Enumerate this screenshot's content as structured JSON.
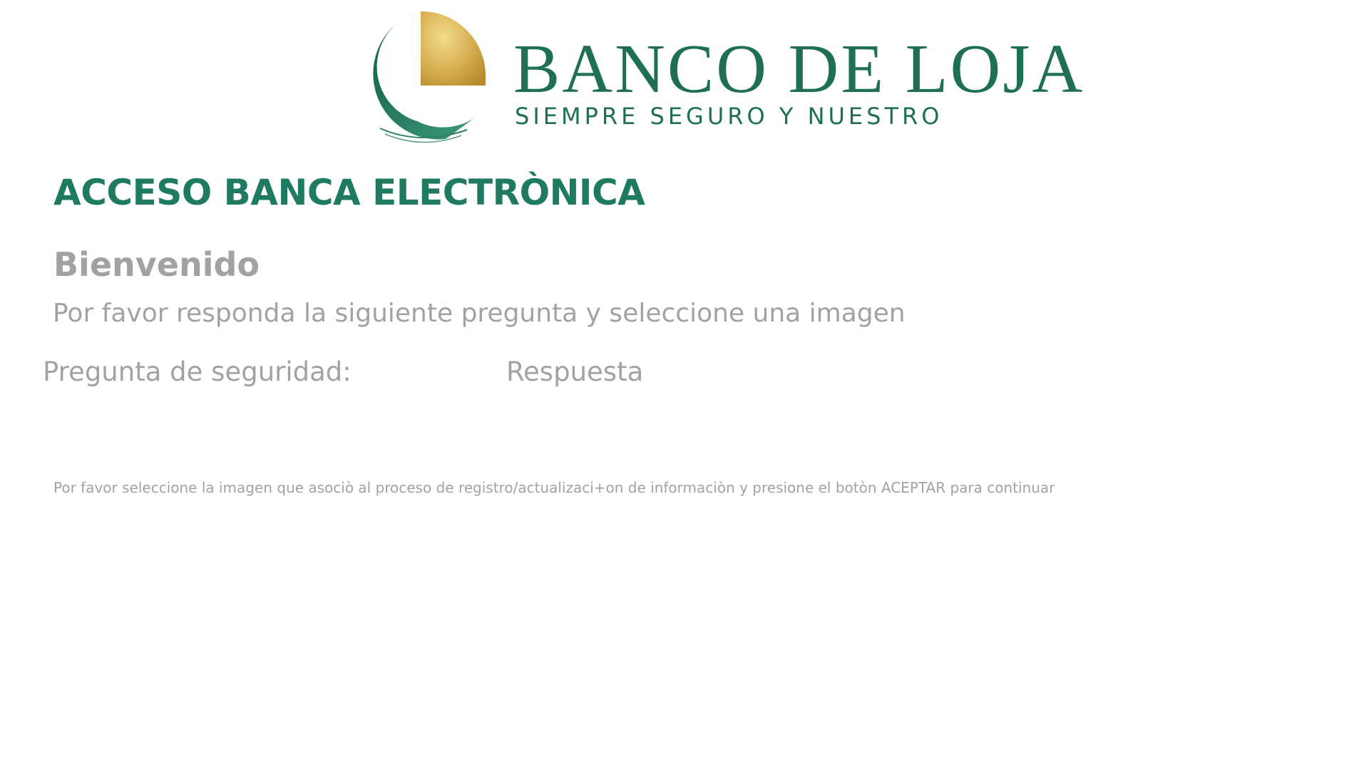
{
  "logo": {
    "name": "BANCO DE LOJA",
    "tagline": "SIEMPRE SEGURO Y NUESTRO",
    "colors": {
      "green": "#1f6e56",
      "gold": "#c9a347"
    }
  },
  "page": {
    "title": "ACCESO BANCA ELECTRÒNICA",
    "welcome": "Bienvenido",
    "instruction": "Por favor responda la siguiente pregunta y seleccione una imagen"
  },
  "security": {
    "question_label": "Pregunta de seguridad:",
    "answer_label": "Respuesta"
  },
  "image_selection": {
    "instruction": "Por favor seleccione la imagen que asociò al proceso de registro/actualizaci+on de informaciòn y presione el botòn ACEPTAR para continuar"
  },
  "colors": {
    "title": "#1f7a62",
    "text_gray": "#a2a2a2"
  }
}
